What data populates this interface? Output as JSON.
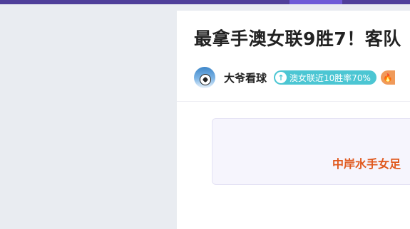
{
  "article": {
    "title": "最拿手澳女联9胜7！客队",
    "author": {
      "name": "大爷看球",
      "tag": "澳女联近10胜率70%"
    },
    "card": {
      "headline": "中岸水手女足"
    }
  },
  "colors": {
    "topbar": "#4f3f9a",
    "tag": "#4cc6d3",
    "accent_orange": "#e0581d",
    "fire_badge": "#f09a5a"
  },
  "icons": {
    "tag_icon": "arrow-up-icon",
    "badge_icon": "fire-icon",
    "avatar": "soccer-ball-avatar"
  }
}
